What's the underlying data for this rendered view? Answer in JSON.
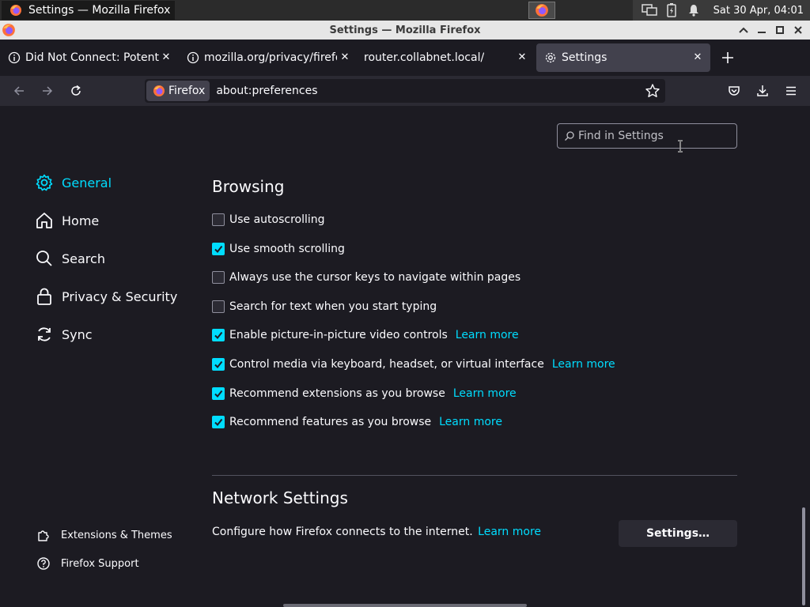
{
  "taskbar": {
    "app_title": "Settings — Mozilla Firefox",
    "clock": "Sat 30 Apr, 04:01"
  },
  "window": {
    "title": "Settings — Mozilla Firefox"
  },
  "tabs": [
    {
      "label": "Did Not Connect: Potentially",
      "icon": "info-icon"
    },
    {
      "label": "mozilla.org/privacy/firefox",
      "icon": "info-icon"
    },
    {
      "label": "router.collabnet.local/",
      "icon": ""
    },
    {
      "label": "Settings",
      "icon": "gear-icon",
      "active": true
    }
  ],
  "navbar": {
    "identity_label": "Firefox",
    "url": "about:preferences"
  },
  "search": {
    "placeholder": "Find in Settings"
  },
  "sidebar": {
    "items": [
      {
        "label": "General",
        "icon": "gear-icon",
        "active": true
      },
      {
        "label": "Home",
        "icon": "home-icon"
      },
      {
        "label": "Search",
        "icon": "search-icon"
      },
      {
        "label": "Privacy & Security",
        "icon": "lock-icon"
      },
      {
        "label": "Sync",
        "icon": "sync-icon"
      }
    ],
    "footer": [
      {
        "label": "Extensions & Themes",
        "icon": "puzzle-icon"
      },
      {
        "label": "Firefox Support",
        "icon": "help-icon"
      }
    ]
  },
  "browsing": {
    "heading": "Browsing",
    "options": [
      {
        "label": "Use autoscrolling",
        "checked": false,
        "learn_more": ""
      },
      {
        "label": "Use smooth scrolling",
        "checked": true,
        "learn_more": ""
      },
      {
        "label": "Always use the cursor keys to navigate within pages",
        "checked": false,
        "learn_more": ""
      },
      {
        "label": "Search for text when you start typing",
        "checked": false,
        "learn_more": ""
      },
      {
        "label": "Enable picture-in-picture video controls",
        "checked": true,
        "learn_more": "Learn more"
      },
      {
        "label": "Control media via keyboard, headset, or virtual interface",
        "checked": true,
        "learn_more": "Learn more"
      },
      {
        "label": "Recommend extensions as you browse",
        "checked": true,
        "learn_more": "Learn more"
      },
      {
        "label": "Recommend features as you browse",
        "checked": true,
        "learn_more": "Learn more"
      }
    ]
  },
  "network": {
    "heading": "Network Settings",
    "description": "Configure how Firefox connects to the internet.",
    "learn_more": "Learn more",
    "button_label": "Settings…"
  },
  "colors": {
    "accent": "#00ddff",
    "background": "#1c1b22",
    "toolbar": "#2b2a33"
  }
}
